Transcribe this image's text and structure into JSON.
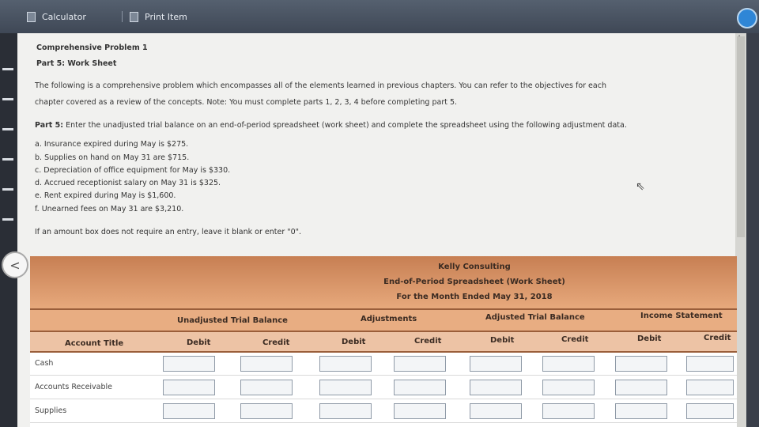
{
  "toolbar": {
    "calculator": "Calculator",
    "print_item": "Print Item"
  },
  "problem": {
    "title": "Comprehensive Problem 1",
    "part": "Part 5: Work Sheet",
    "intro_1": "The following is a comprehensive problem which encompasses all of the elements learned in previous chapters. You can refer to the objectives for each",
    "intro_2": "chapter covered as a review of the concepts. Note: You must complete parts 1, 2, 3, 4 before completing part 5.",
    "part5_label": "Part 5:",
    "part5_text": "Enter the unadjusted trial balance on an end-of-period spreadsheet (work sheet) and complete the spreadsheet using the following adjustment data.",
    "adjustments": [
      "a. Insurance expired during May is $275.",
      "b. Supplies on hand on May 31 are $715.",
      "c. Depreciation of office equipment for May is $330.",
      "d. Accrued receptionist salary on May 31 is $325.",
      "e. Rent expired during May is $1,600.",
      "f. Unearned fees on May 31 are $3,210."
    ],
    "instruction": "If an amount box does not require an entry, leave it blank or enter \"0\"."
  },
  "worksheet": {
    "company": "Kelly Consulting",
    "title": "End-of-Period Spreadsheet (Work Sheet)",
    "period": "For the Month Ended May 31, 2018",
    "groups": [
      "Unadjusted Trial Balance",
      "Adjustments",
      "Adjusted Trial Balance",
      "Income Statement"
    ],
    "account_title": "Account Title",
    "debit": "Debit",
    "credit": "Credit",
    "accounts": [
      "Cash",
      "Accounts Receivable",
      "Supplies"
    ]
  }
}
